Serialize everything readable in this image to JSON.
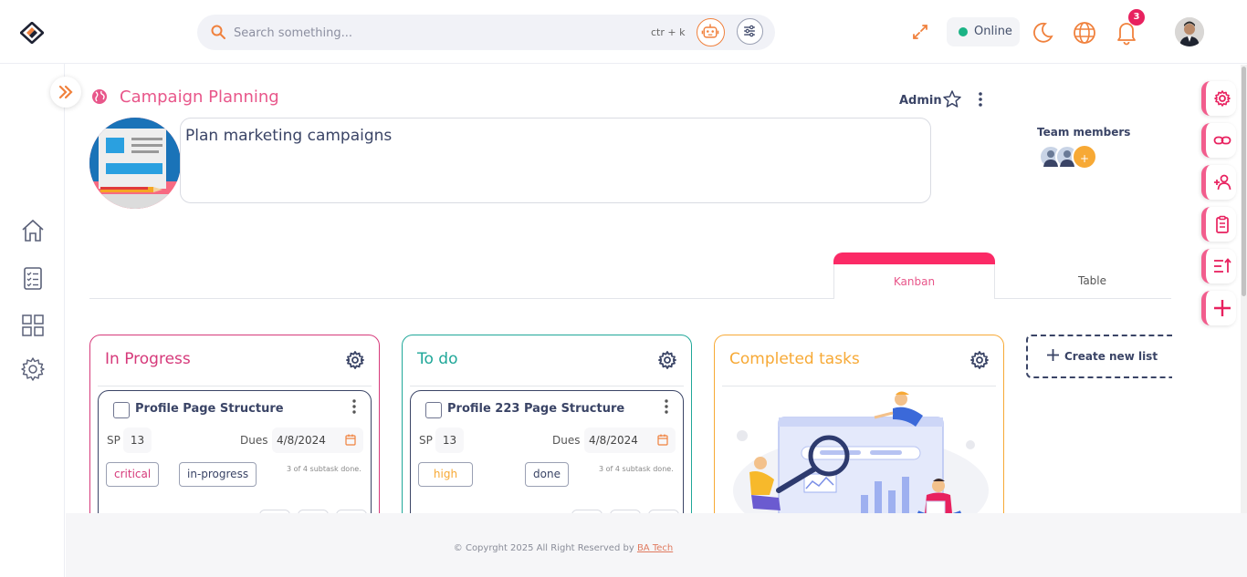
{
  "header": {
    "search_placeholder": "Search something...",
    "search_shortcut": "ctr + k",
    "status_label": "Online",
    "notification_count": "3"
  },
  "project": {
    "title": "Campaign Planning",
    "role": "Admin",
    "description": "Plan marketing campaigns",
    "team_label": "Team members",
    "team_more": "+"
  },
  "tabs": [
    {
      "label": "Kanban",
      "active": true
    },
    {
      "label": "Table",
      "active": false
    }
  ],
  "lists": [
    {
      "title": "In Progress",
      "color": "#d6397a",
      "card": {
        "title": "Profile Page Structure",
        "sp_label": "SP",
        "sp_value": "13",
        "due_label": "Dues",
        "due_value": "4/8/2024",
        "priority": "critical",
        "priority_color": "#d6397a",
        "status": "in-progress",
        "subtasks": "3 of 4 subtask done."
      }
    },
    {
      "title": "To do",
      "color": "#1fa799",
      "card": {
        "title": "Profile 223 Page Structure",
        "sp_label": "SP",
        "sp_value": "13",
        "due_label": "Dues",
        "due_value": "4/8/2024",
        "priority": "high",
        "priority_color": "#f7a935",
        "status": "done",
        "subtasks": "3 of 4 subtask done."
      }
    },
    {
      "title": "Completed tasks",
      "color": "#f7a935"
    }
  ],
  "new_list_label": "Create new list",
  "footer": {
    "copyright": "© Copyrght 2025 All Right Reserved by ",
    "brand": "BA Tech"
  },
  "colors": {
    "accent": "#fb2a66",
    "orange": "#f0813d",
    "navy": "#3a4466"
  }
}
